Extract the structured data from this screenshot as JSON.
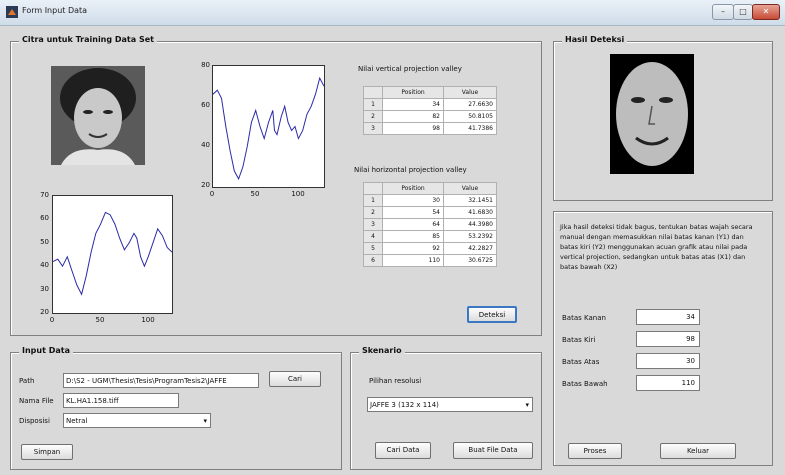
{
  "window": {
    "title": "Form Input Data",
    "minimize": "–",
    "maximize": "□",
    "close": "✕"
  },
  "training_panel": {
    "title": "Citra untuk Training Data Set",
    "vertical_table": {
      "caption": "Nilai vertical projection valley",
      "headers": [
        "Position",
        "Value"
      ],
      "rows": [
        {
          "idx": "1",
          "position": "34",
          "value": "27.6630"
        },
        {
          "idx": "2",
          "position": "82",
          "value": "50.8105"
        },
        {
          "idx": "3",
          "position": "98",
          "value": "41.7386"
        }
      ]
    },
    "horizontal_table": {
      "caption": "Nilai horizontal projection valley",
      "headers": [
        "Position",
        "Value"
      ],
      "rows": [
        {
          "idx": "1",
          "position": "30",
          "value": "32.1451"
        },
        {
          "idx": "2",
          "position": "54",
          "value": "41.6830"
        },
        {
          "idx": "3",
          "position": "64",
          "value": "44.3980"
        },
        {
          "idx": "4",
          "position": "85",
          "value": "53.2392"
        },
        {
          "idx": "5",
          "position": "92",
          "value": "42.2827"
        },
        {
          "idx": "6",
          "position": "110",
          "value": "30.6725"
        }
      ]
    },
    "detect_button": "Deteksi"
  },
  "chart_data": [
    {
      "type": "line",
      "ylim": [
        20,
        80
      ],
      "xlim": [
        0,
        130
      ],
      "yticks": [
        "80",
        "60",
        "40",
        "20"
      ],
      "xticks": [
        "0",
        "50",
        "100"
      ],
      "series": [
        {
          "values": [
            [
              0,
              66
            ],
            [
              5,
              68
            ],
            [
              10,
              64
            ],
            [
              15,
              50
            ],
            [
              20,
              38
            ],
            [
              25,
              28
            ],
            [
              30,
              24
            ],
            [
              35,
              30
            ],
            [
              40,
              40
            ],
            [
              45,
              52
            ],
            [
              50,
              58
            ],
            [
              55,
              50
            ],
            [
              60,
              44
            ],
            [
              65,
              52
            ],
            [
              70,
              58
            ],
            [
              72,
              48
            ],
            [
              75,
              46
            ],
            [
              80,
              55
            ],
            [
              84,
              60
            ],
            [
              88,
              52
            ],
            [
              92,
              48
            ],
            [
              96,
              50
            ],
            [
              100,
              44
            ],
            [
              105,
              48
            ],
            [
              110,
              56
            ],
            [
              115,
              60
            ],
            [
              120,
              66
            ],
            [
              125,
              74
            ],
            [
              130,
              70
            ]
          ]
        }
      ]
    },
    {
      "type": "line",
      "ylim": [
        20,
        70
      ],
      "xlim": [
        0,
        125
      ],
      "yticks": [
        "70",
        "60",
        "50",
        "40",
        "30",
        "20"
      ],
      "xticks": [
        "0",
        "50",
        "100"
      ],
      "series": [
        {
          "values": [
            [
              0,
              42
            ],
            [
              5,
              43
            ],
            [
              10,
              40
            ],
            [
              15,
              44
            ],
            [
              20,
              38
            ],
            [
              25,
              32
            ],
            [
              30,
              28
            ],
            [
              35,
              36
            ],
            [
              40,
              46
            ],
            [
              45,
              54
            ],
            [
              50,
              58
            ],
            [
              55,
              63
            ],
            [
              60,
              62
            ],
            [
              65,
              58
            ],
            [
              70,
              52
            ],
            [
              75,
              47
            ],
            [
              80,
              50
            ],
            [
              85,
              54
            ],
            [
              88,
              52
            ],
            [
              92,
              44
            ],
            [
              96,
              40
            ],
            [
              100,
              44
            ],
            [
              105,
              50
            ],
            [
              110,
              56
            ],
            [
              115,
              53
            ],
            [
              120,
              48
            ],
            [
              125,
              46
            ]
          ]
        }
      ]
    }
  ],
  "result_panel": {
    "title": "Hasil Deteksi"
  },
  "info_panel": {
    "note": "Jika hasil deteksi tidak bagus, tentukan batas wajah secara manual dengan memasukkan nilai batas kanan (Y1) dan batas kiri (Y2) menggunakan acuan grafik atau nilai pada vertical projection, sedangkan untuk batas atas (X1) dan batas bawah (X2)",
    "fields": [
      {
        "label": "Batas Kanan",
        "value": "34"
      },
      {
        "label": "Batas Kiri",
        "value": "98"
      },
      {
        "label": "Batas Atas",
        "value": "30"
      },
      {
        "label": "Batas Bawah",
        "value": "110"
      }
    ],
    "process_button": "Proses",
    "exit_button": "Keluar"
  },
  "input_panel": {
    "title": "Input Data",
    "path_label": "Path",
    "path_value": "D:\\S2 - UGM\\Thesis\\Tesis\\ProgramTesis2\\JAFFE",
    "browse_button": "Cari",
    "filename_label": "Nama File",
    "filename_value": "KL.HA1.158.tiff",
    "disposition_label": "Disposisi",
    "disposition_value": "Netral",
    "save_button": "Simpan"
  },
  "scenario_panel": {
    "title": "Skenario",
    "resolution_label": "Pilihan resolusi",
    "resolution_value": "JAFFE 3 (132 x 114)",
    "search_button": "Cari Data",
    "create_button": "Buat File Data"
  }
}
